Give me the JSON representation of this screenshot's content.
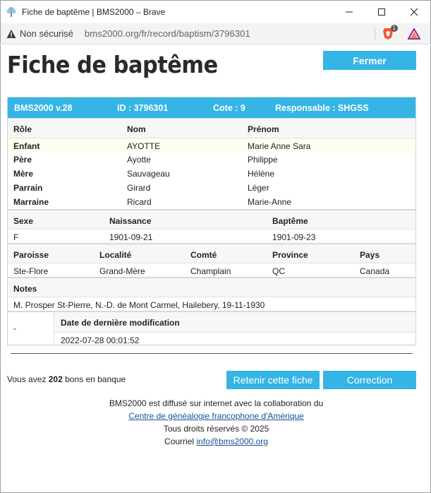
{
  "window": {
    "title": "Fiche de baptême | BMS2000 – Brave",
    "minimize": "—",
    "maximize": "☐",
    "close": "✕"
  },
  "address": {
    "security": "Non sécurisé",
    "url": "bms2000.org/fr/record/baptism/3796301",
    "brave_badge": "1"
  },
  "page": {
    "title": "Fiche de baptême",
    "close_button": "Fermer"
  },
  "record_header": {
    "version": "BMS2000 v.28",
    "id": "ID : 3796301",
    "cote": "Cote : 9",
    "responsable": "Responsable : SHGSS"
  },
  "persons": {
    "headers": [
      "Rôle",
      "Nom",
      "Prénom"
    ],
    "rows": [
      {
        "role": "Enfant",
        "nom": "AYOTTE",
        "prenom": "Marie Anne Sara"
      },
      {
        "role": "Père",
        "nom": "Ayotte",
        "prenom": "Philippe"
      },
      {
        "role": "Mère",
        "nom": "Sauvageau",
        "prenom": "Hélène"
      },
      {
        "role": "Parrain",
        "nom": "Girard",
        "prenom": "Léger"
      },
      {
        "role": "Marraine",
        "nom": "Ricard",
        "prenom": "Marie-Anne"
      }
    ]
  },
  "vitals": {
    "headers": [
      "Sexe",
      "Naissance",
      "Baptême"
    ],
    "values": [
      "F",
      "1901-09-21",
      "1901-09-23"
    ]
  },
  "place": {
    "headers": [
      "Paroisse",
      "Localité",
      "Comté",
      "Province",
      "Pays"
    ],
    "values": [
      "Ste-Flore",
      "Grand-Mère",
      "Champlain",
      "QC",
      "Canada"
    ]
  },
  "notes": {
    "header": "Notes",
    "text": "M. Prosper St-Pierre, N.-D. de Mont Carmel, Hailebery, 19-11-1930"
  },
  "modification": {
    "left": "-",
    "header": "Date de dernière modification",
    "value": "2022-07-28 00:01:52"
  },
  "footer": {
    "bank_prefix": "Vous avez",
    "bank_count": "202",
    "bank_suffix": "bons en banque",
    "retain_button": "Retenir cette fiche",
    "correction_button": "Correction",
    "credit_line1": "BMS2000 est diffusé sur internet avec la collaboration du",
    "credit_link": "Centre de généalogie francophone d'Amérique",
    "rights": "Tous droits réservés © 2025",
    "email_label": "Courriel",
    "email": "info@bms2000.org"
  },
  "colors": {
    "accent": "#34b5e5",
    "highlight_row": "#fffdee",
    "link": "#1a4f9a"
  }
}
